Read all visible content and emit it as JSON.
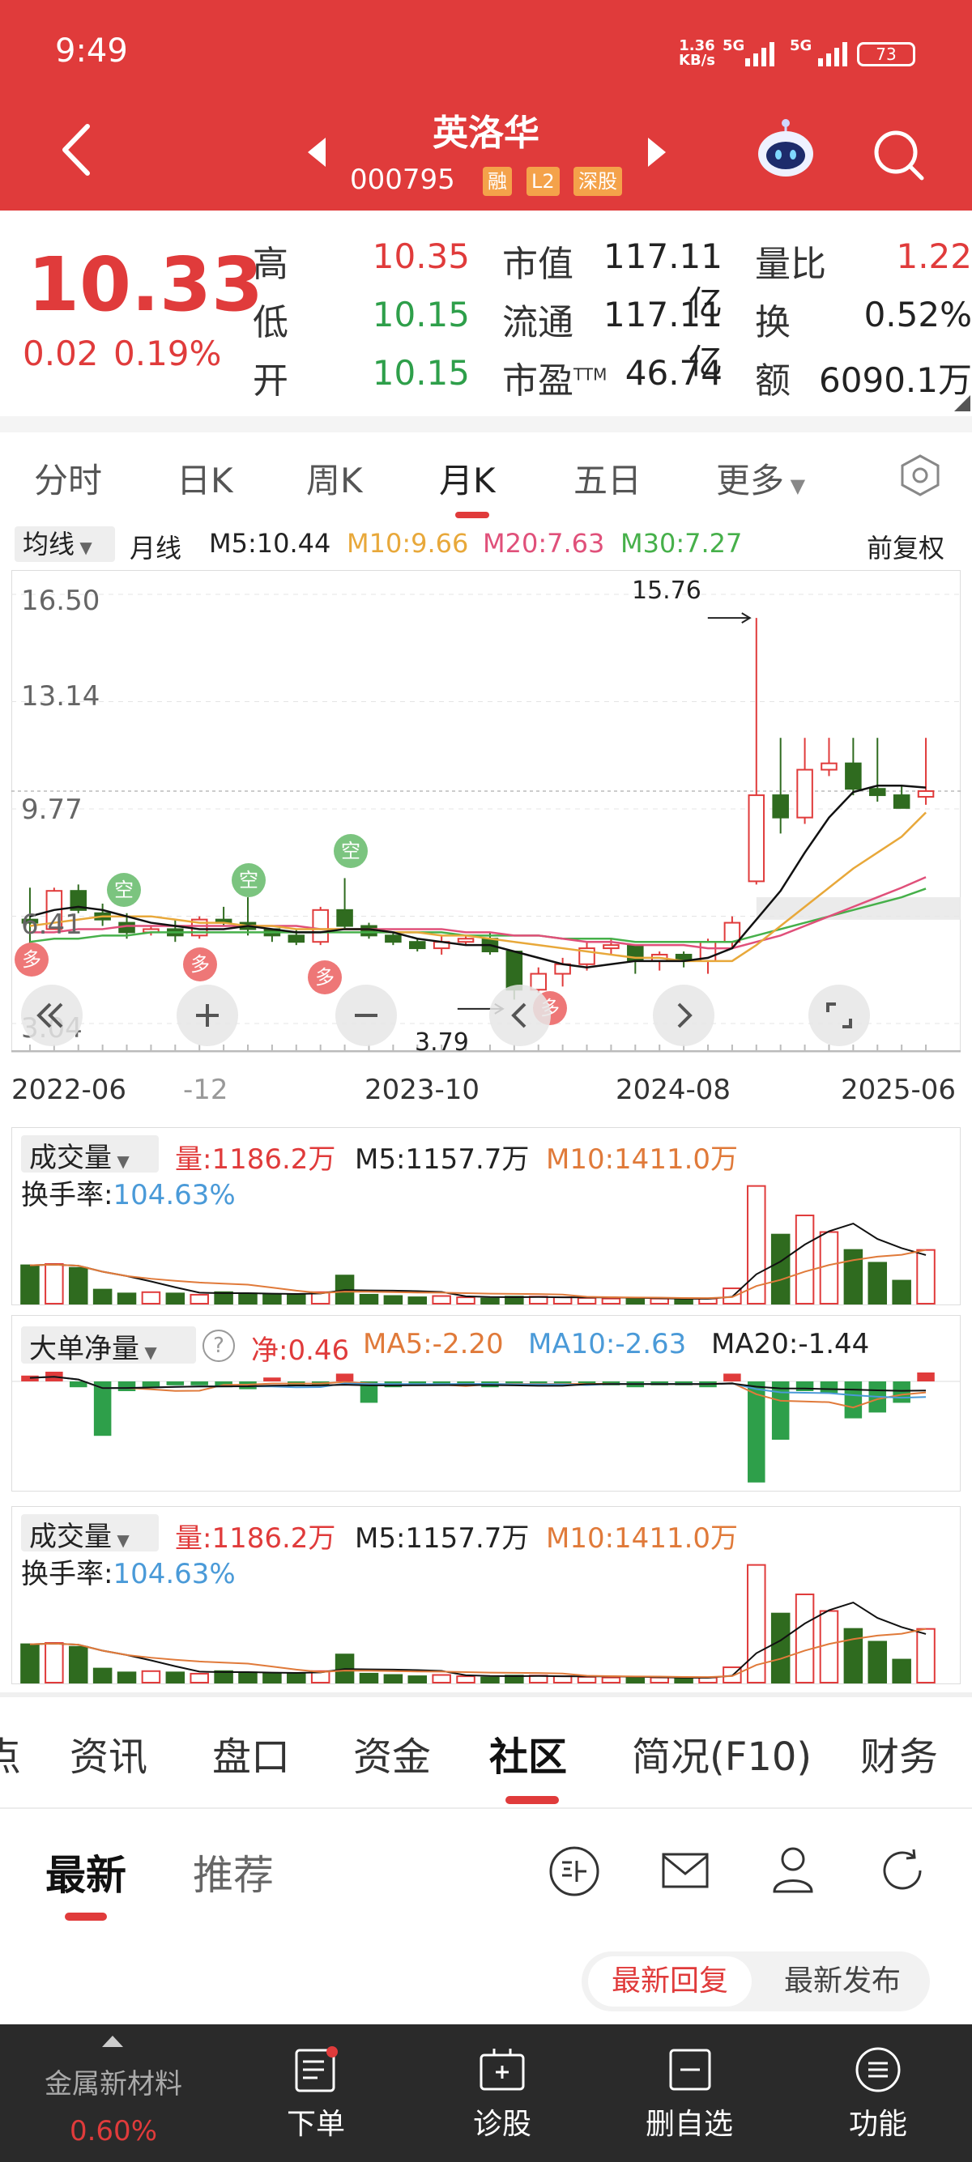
{
  "status_bar": {
    "time": "9:49",
    "net_speed_value": "1.36",
    "net_speed_unit": "KB/s",
    "sig1": "5G",
    "sig2": "5G",
    "battery": "73"
  },
  "header": {
    "stock_name": "英洛华",
    "stock_code": "000795",
    "tags": [
      "融",
      "L2",
      "深股"
    ]
  },
  "quote": {
    "price": "10.33",
    "change": "0.02",
    "change_pct": "0.19%",
    "rows": [
      {
        "l1": "高",
        "v1": "10.35",
        "l2": "市值",
        "v2": "117.11亿",
        "l3": "量比",
        "v3": "1.22"
      },
      {
        "l1": "低",
        "v1": "10.15",
        "l2": "流通",
        "v2": "117.11亿",
        "l3": "换",
        "v3": "0.52%"
      },
      {
        "l1": "开",
        "v1": "10.15",
        "l2": "市盈",
        "l2sup": "TTM",
        "v2": "46.74",
        "l3": "额",
        "v3": "6090.1万"
      }
    ]
  },
  "chart_tabs": [
    "分时",
    "日K",
    "周K",
    "月K",
    "五日",
    "更多"
  ],
  "ma_bar": {
    "select": "均线",
    "period": "月线",
    "m5": "M5:10.44",
    "m10": "M10:9.66",
    "m20": "M20:7.63",
    "m30": "M30:7.27",
    "adjust": "前复权"
  },
  "colors": {
    "red": "#e03b3b",
    "green": "#2e9f4a",
    "dark_green": "#2f6b1f",
    "orange": "#e07a3a",
    "blue": "#4a9ad8",
    "yellow": "#e8a83a"
  },
  "chart_data": {
    "type": "candlestick",
    "period": "month",
    "y_ticks": [
      "16.50",
      "13.14",
      "9.77",
      "6.41",
      "3.04"
    ],
    "x_ticks": [
      "2022-06",
      "-12",
      "2023-10",
      "2024-08",
      "2025-06"
    ],
    "ylim": [
      3.04,
      16.5
    ],
    "annotations": [
      {
        "label": "15.76"
      },
      {
        "label": "3.79"
      }
    ],
    "markers": [
      "多",
      "空",
      "空",
      "多",
      "空",
      "多",
      "多"
    ],
    "candles": [
      [
        6.3,
        7.3,
        5.5,
        6.2
      ],
      [
        6.0,
        7.3,
        6.0,
        7.2
      ],
      [
        7.2,
        7.4,
        6.5,
        6.6
      ],
      [
        6.5,
        6.8,
        6.1,
        6.3
      ],
      [
        6.2,
        6.5,
        5.7,
        5.9
      ],
      [
        5.9,
        6.1,
        5.8,
        6.0
      ],
      [
        6.0,
        6.3,
        5.6,
        5.8
      ],
      [
        5.8,
        6.4,
        5.7,
        6.3
      ],
      [
        6.3,
        6.7,
        6.1,
        6.2
      ],
      [
        6.2,
        7.0,
        5.8,
        6.0
      ],
      [
        6.0,
        6.0,
        5.6,
        5.8
      ],
      [
        5.8,
        6.0,
        5.5,
        5.6
      ],
      [
        5.6,
        6.7,
        5.5,
        6.6
      ],
      [
        6.6,
        7.6,
        6.0,
        6.1
      ],
      [
        6.1,
        6.2,
        5.7,
        5.8
      ],
      [
        5.8,
        5.9,
        5.5,
        5.6
      ],
      [
        5.6,
        5.7,
        5.3,
        5.4
      ],
      [
        5.4,
        5.8,
        5.2,
        5.6
      ],
      [
        5.6,
        5.8,
        5.5,
        5.7
      ],
      [
        5.7,
        5.9,
        5.2,
        5.3
      ],
      [
        5.3,
        5.3,
        3.79,
        4.1
      ],
      [
        4.1,
        4.8,
        4.0,
        4.6
      ],
      [
        4.6,
        5.1,
        4.2,
        4.9
      ],
      [
        4.9,
        5.6,
        4.7,
        5.4
      ],
      [
        5.4,
        5.7,
        5.2,
        5.5
      ],
      [
        5.5,
        5.5,
        4.6,
        5.0
      ],
      [
        5.0,
        5.3,
        4.7,
        5.2
      ],
      [
        5.2,
        5.3,
        4.8,
        5.0
      ],
      [
        5.0,
        5.7,
        4.6,
        5.6
      ],
      [
        5.6,
        6.4,
        5.4,
        6.2
      ],
      [
        7.5,
        15.76,
        7.4,
        10.2
      ],
      [
        10.2,
        12.0,
        9.0,
        9.5
      ],
      [
        9.5,
        12.0,
        9.3,
        11.0
      ],
      [
        11.0,
        12.0,
        10.8,
        11.2
      ],
      [
        11.2,
        12.0,
        10.2,
        10.4
      ],
      [
        10.4,
        12.0,
        10.0,
        10.2
      ],
      [
        10.2,
        10.5,
        9.8,
        9.8
      ],
      [
        10.15,
        12.0,
        9.9,
        10.33
      ]
    ],
    "ma5": [
      6.4,
      6.6,
      6.7,
      6.6,
      6.4,
      6.2,
      6.1,
      6.0,
      6.0,
      6.1,
      6.0,
      5.9,
      5.9,
      6.0,
      6.0,
      5.9,
      5.7,
      5.6,
      5.5,
      5.5,
      5.3,
      5.1,
      4.9,
      4.8,
      4.9,
      5.0,
      5.0,
      5.0,
      5.1,
      5.4,
      6.3,
      7.2,
      8.4,
      9.5,
      10.3,
      10.5,
      10.5,
      10.44
    ],
    "ma10": [
      6.1,
      6.2,
      6.3,
      6.4,
      6.4,
      6.4,
      6.3,
      6.2,
      6.2,
      6.1,
      6.1,
      6.0,
      6.0,
      6.0,
      6.0,
      5.9,
      5.9,
      5.8,
      5.8,
      5.7,
      5.6,
      5.5,
      5.4,
      5.3,
      5.2,
      5.1,
      5.1,
      5.0,
      5.0,
      5.0,
      5.5,
      6.1,
      6.7,
      7.3,
      7.9,
      8.4,
      8.9,
      9.66
    ],
    "ma20": [
      5.9,
      5.9,
      6.0,
      6.0,
      6.1,
      6.1,
      6.1,
      6.1,
      6.1,
      6.1,
      6.1,
      6.1,
      6.0,
      6.0,
      6.0,
      6.0,
      6.0,
      6.0,
      5.9,
      5.9,
      5.8,
      5.8,
      5.7,
      5.6,
      5.6,
      5.5,
      5.5,
      5.5,
      5.4,
      5.4,
      5.6,
      5.8,
      6.1,
      6.4,
      6.7,
      7.0,
      7.3,
      7.63
    ],
    "ma30": [
      5.6,
      5.7,
      5.7,
      5.8,
      5.8,
      5.9,
      5.9,
      5.9,
      5.9,
      5.9,
      5.9,
      5.9,
      5.9,
      5.9,
      5.9,
      5.9,
      5.9,
      5.9,
      5.8,
      5.8,
      5.8,
      5.8,
      5.7,
      5.7,
      5.7,
      5.6,
      5.6,
      5.6,
      5.6,
      5.6,
      5.8,
      6.0,
      6.2,
      6.4,
      6.6,
      6.8,
      7.0,
      7.27
    ],
    "volume_panel": {
      "label": "成交量",
      "vol": "量:1186.2万",
      "m5": "M5:1157.7万",
      "m10": "M10:1411.0万",
      "turnover_label": "换手率:",
      "turnover": "104.63%",
      "vol_values": [
        300,
        310,
        280,
        110,
        80,
        90,
        80,
        70,
        90,
        80,
        70,
        70,
        90,
        220,
        70,
        60,
        50,
        60,
        50,
        40,
        55,
        55,
        50,
        45,
        40,
        40,
        40,
        30,
        40,
        120,
        920,
        540,
        690,
        560,
        420,
        320,
        180,
        420
      ]
    },
    "flow_panel": {
      "label": "大单净量",
      "net": "净:0.46",
      "ma5": "MA5:-2.20",
      "ma10": "MA10:-2.63",
      "ma20": "MA20:-1.44",
      "flow_values": [
        0.3,
        0.5,
        -0.3,
        -2.8,
        -0.5,
        -0.3,
        -0.2,
        -0.2,
        -0.3,
        -0.4,
        0.2,
        -0.2,
        -0.2,
        0.4,
        -1.1,
        -0.3,
        -0.2,
        -0.2,
        -0.2,
        -0.3,
        -0.2,
        -0.2,
        -0.2,
        -0.2,
        -0.2,
        -0.3,
        -0.2,
        -0.2,
        -0.3,
        0.4,
        -5.2,
        -3.0,
        -0.5,
        -0.6,
        -1.9,
        -1.6,
        -1.1,
        0.46
      ]
    }
  },
  "bottom_tabs": [
    "点",
    "资讯",
    "盘口",
    "资金",
    "社区",
    "简况(F10)",
    "财务"
  ],
  "sub_tabs": [
    "最新",
    "推荐"
  ],
  "sort_options": [
    "最新回复",
    "最新发布"
  ],
  "bottom_bar": {
    "sector": "金属新材料",
    "sector_pct": "0.60%",
    "items": [
      "下单",
      "诊股",
      "删自选",
      "功能"
    ]
  }
}
